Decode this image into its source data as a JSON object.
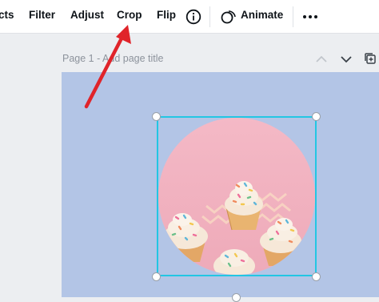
{
  "toolbar": {
    "effects_partial": "cts",
    "filter": "Filter",
    "adjust": "Adjust",
    "crop": "Crop",
    "flip": "Flip",
    "info_icon": "info-circle-icon",
    "animate": "Animate",
    "more_icon": "more-horizontal-icon"
  },
  "page_bar": {
    "title": "Page 1 - Add page title",
    "collapse_icon": "chevron-up-icon",
    "expand_icon": "chevron-down-icon",
    "duplicate_icon": "duplicate-page-icon"
  },
  "canvas": {
    "background_color": "#b3c5e6",
    "selection_color": "#23c6e3",
    "image_subject": "cupcakes-photo"
  },
  "annotation": {
    "arrow_color": "#e0242a"
  }
}
